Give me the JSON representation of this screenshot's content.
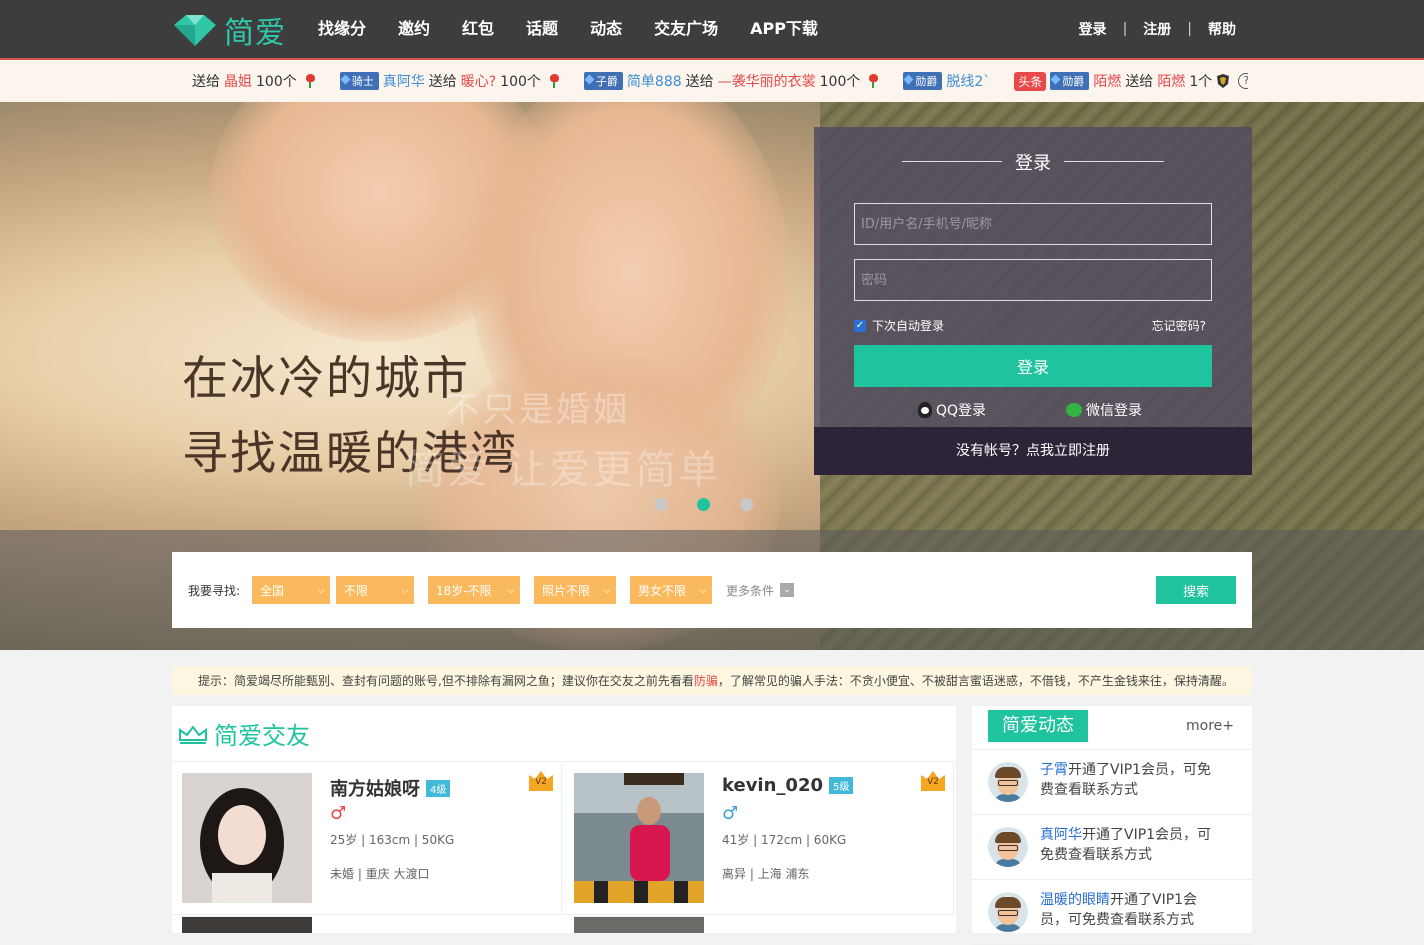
{
  "brand": {
    "name": "简爱",
    "color": "#2fc7a8"
  },
  "nav": {
    "items": [
      "找缘分",
      "邀约",
      "红包",
      "话题",
      "动态",
      "交友广场",
      "APP下载"
    ],
    "login": "登录",
    "register": "注册",
    "help": "帮助",
    "separator": "|"
  },
  "ticker": {
    "items": [
      {
        "lead": "送给",
        "to": "晶姐",
        "amount": "100个"
      },
      {
        "badge": "骑士",
        "from": "真阿华",
        "verb": "送给",
        "to": "暖心?",
        "amount": "100个"
      },
      {
        "badge": "子爵",
        "from": "简单888",
        "verb": "送给",
        "to": "—袭华丽的衣裳",
        "amount": "100个"
      },
      {
        "badge": "勋爵",
        "from": "脱线2`"
      },
      {
        "headline": "头条",
        "badge": "勋爵",
        "from": "陌燃",
        "verb": "送给",
        "to": "陌燃",
        "amount": "1个"
      }
    ],
    "help_icon": "?"
  },
  "hero": {
    "line1": "在冰冷的城市",
    "line2": "寻找温暖的港湾",
    "ghost1": "不只是婚姻",
    "ghost2": "简爱 让爱更简单",
    "active_slide": 1,
    "slide_count": 3
  },
  "login": {
    "title": "登录",
    "username_placeholder": "ID/用户名/手机号/昵称",
    "password_placeholder": "密码",
    "remember_label": "下次自动登录",
    "remember_checked": true,
    "forgot": "忘记密码?",
    "submit": "登录",
    "qq": "QQ登录",
    "wechat": "微信登录",
    "register_prompt": "没有帐号？点我立即注册"
  },
  "search": {
    "label": "我要寻找:",
    "filters": [
      "全国",
      "不限",
      "18岁-不限",
      "照片不限",
      "男女不限"
    ],
    "more": "更多条件",
    "button": "搜索"
  },
  "notice": {
    "prefix": "提示：简爱竭尽所能甄别、查封有问题的账号,但不排除有漏网之鱼；建议你在交友之前先看看",
    "warn": "防骗",
    "suffix": "，了解常见的骗人手法：不贪小便宜、不被甜言蜜语迷惑，不借钱，不产生金钱来往，保持清醒。"
  },
  "friends": {
    "title": "简爱交友",
    "cards": [
      {
        "name": "南方姑娘呀",
        "level": "4级",
        "vip": "V2",
        "gender": "♂",
        "gender_color": "#e8484a",
        "stats": "25岁 | 163cm | 50KG",
        "status": "未婚 | 重庆 大渡口"
      },
      {
        "name": "kevin_020",
        "level": "5级",
        "vip": "V2",
        "gender": "♂",
        "gender_color": "#3e9ed8",
        "stats": "41岁 | 172cm | 60KG",
        "status": "离异 | 上海 浦东"
      }
    ]
  },
  "news": {
    "title": "简爱动态",
    "more": "more+",
    "items": [
      {
        "who": "子霄",
        "text": "开通了VIP1会员，可免费查看联系方式"
      },
      {
        "who": "真阿华",
        "text": "开通了VIP1会员，可免费查看联系方式"
      },
      {
        "who": "温暖的眼睛",
        "text": "开通了VIP1会员，可免费查看联系方式"
      }
    ]
  }
}
